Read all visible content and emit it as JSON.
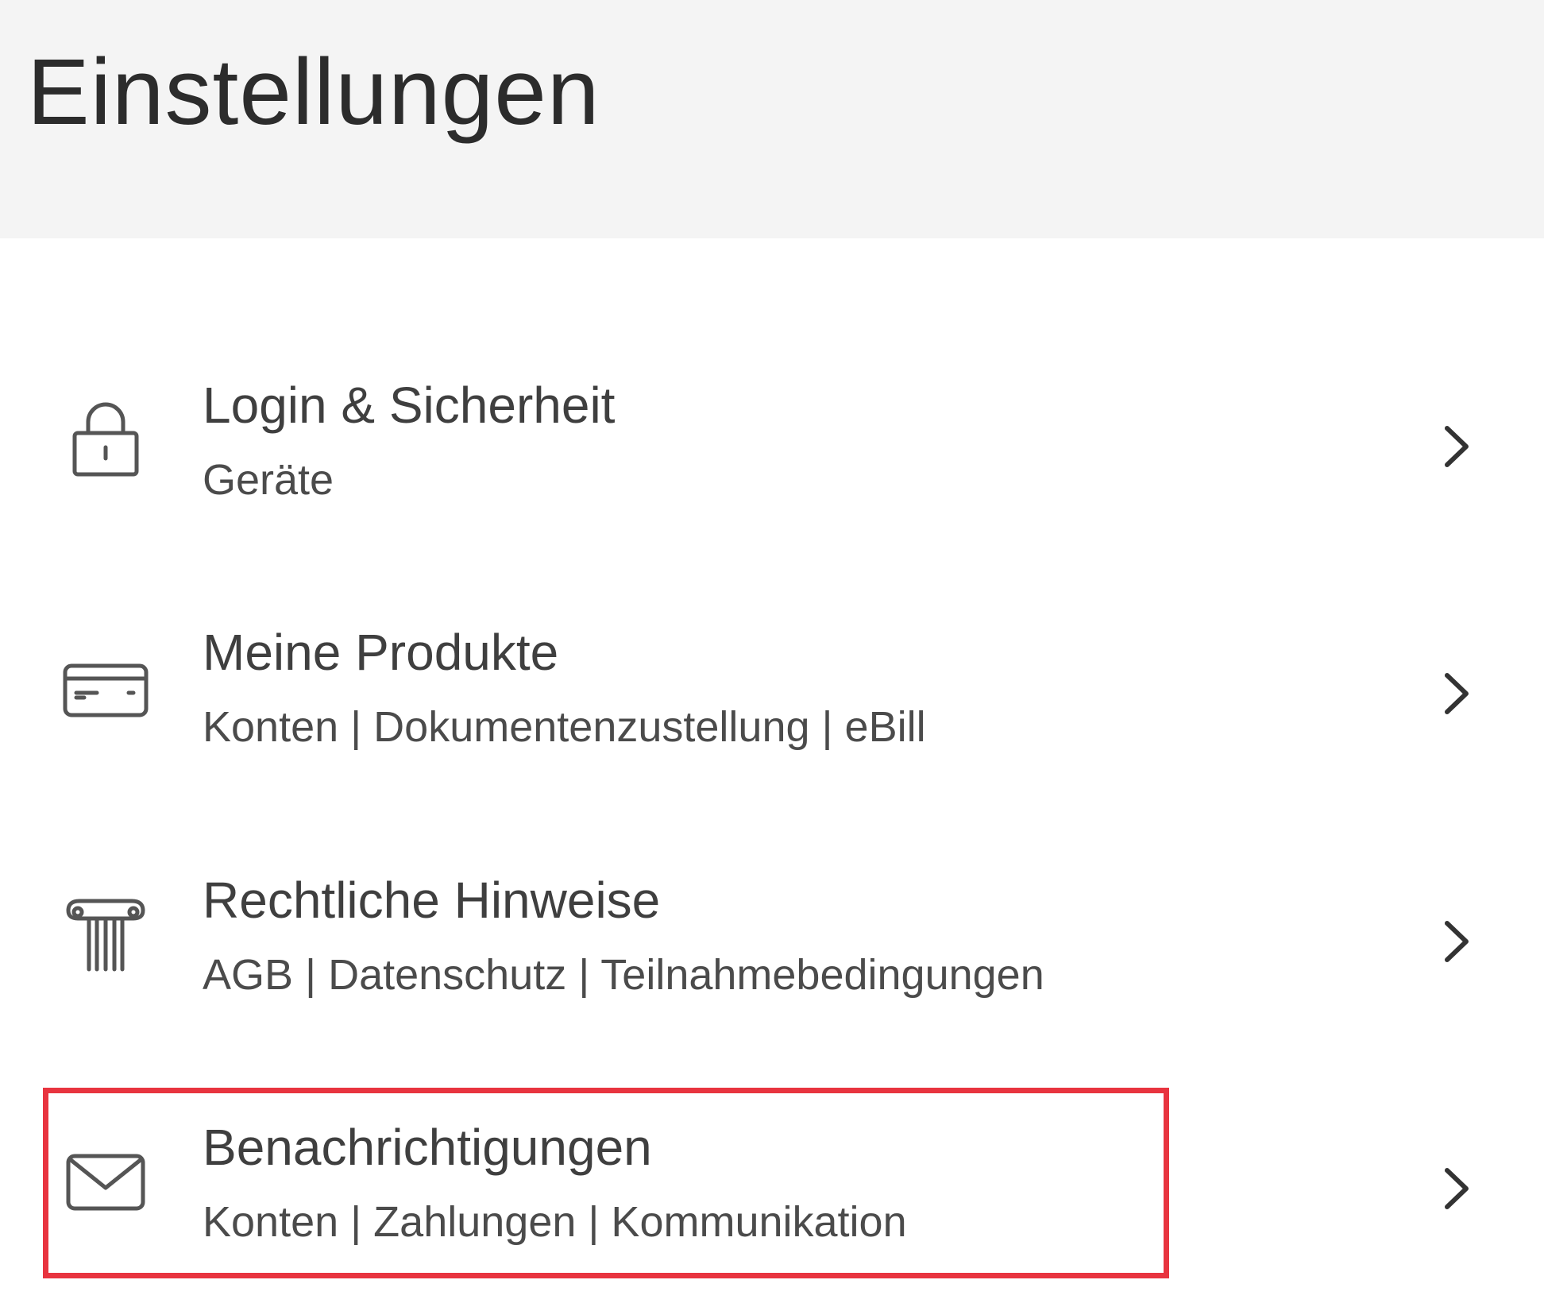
{
  "header": {
    "title": "Einstellungen"
  },
  "menu": {
    "items": [
      {
        "title": "Login & Sicherheit",
        "subtitle": "Geräte",
        "icon": "lock-icon"
      },
      {
        "title": "Meine Produkte",
        "subtitle": "Konten | Dokumentenzustellung | eBill",
        "icon": "card-icon"
      },
      {
        "title": "Rechtliche Hinweise",
        "subtitle": "AGB | Datenschutz | Teilnahmebedingungen",
        "icon": "column-icon"
      },
      {
        "title": "Benachrichtigungen",
        "subtitle": "Konten | Zahlungen | Kommunikation",
        "icon": "envelope-icon"
      }
    ]
  },
  "colors": {
    "header_background": "#f4f4f4",
    "text": "#3f3f3f",
    "icon_stroke": "#555555",
    "highlight": "#e8343f"
  }
}
